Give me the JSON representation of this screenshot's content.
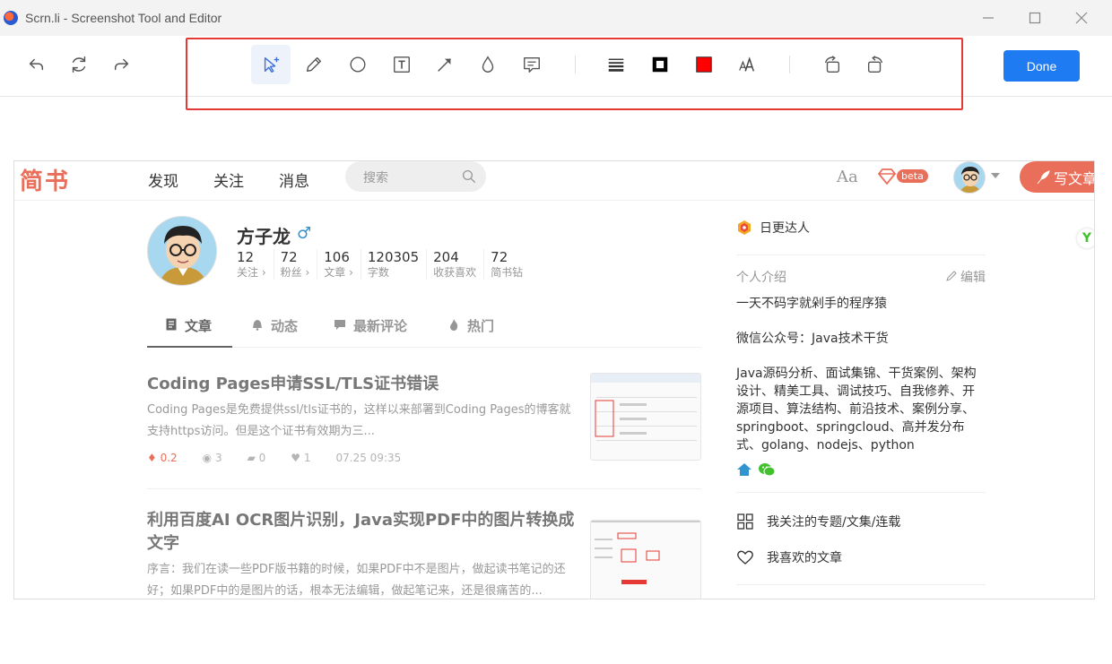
{
  "window": {
    "title": "Scrn.li - Screenshot Tool and Editor",
    "controls": {
      "minimize": "—",
      "maximize": "☐",
      "close": "✕"
    }
  },
  "toolbar": {
    "history": [
      "undo-icon",
      "refresh-icon",
      "redo-icon"
    ],
    "tools": [
      "select-icon",
      "pencil-icon",
      "ellipse-icon",
      "text-tool-icon",
      "arrow-icon",
      "blur-drop-icon",
      "comment-icon"
    ],
    "styles": [
      "line-width-icon",
      "stroke-icon",
      "fill-color-icon",
      "font-size-icon"
    ],
    "rotate": [
      "rotate-left-icon",
      "rotate-right-icon"
    ],
    "colors": {
      "stroke": "#000000",
      "fill": "#ff0000",
      "accent": "#1e7bf2",
      "highlight": "#e53935"
    },
    "done_label": "Done"
  },
  "jianshu": {
    "logo": "简书",
    "nav": [
      "发现",
      "关注",
      "消息"
    ],
    "search_placeholder": "搜索",
    "aa": "Aa",
    "beta": "beta",
    "write_label": "写文章",
    "brand_color": "#ea6f5a"
  },
  "profile": {
    "name": "方子龙",
    "gender_icon": "♂",
    "stats": [
      {
        "num": "12",
        "label": "关注 ›"
      },
      {
        "num": "72",
        "label": "粉丝 ›"
      },
      {
        "num": "106",
        "label": "文章 ›"
      },
      {
        "num": "120305",
        "label": "字数"
      },
      {
        "num": "204",
        "label": "收获喜欢"
      },
      {
        "num": "72",
        "label": "简书钻"
      }
    ]
  },
  "tabs": [
    "文章",
    "动态",
    "最新评论",
    "热门"
  ],
  "articles": [
    {
      "title": "Coding Pages申请SSL/TLS证书错误",
      "desc": "Coding Pages是免费提供ssl/tls证书的，这样以来部署到Coding Pages的博客就支持https访问。但是这个证书有效期为三...",
      "diamond": "0.2",
      "views": "3",
      "comments": "0",
      "likes": "1",
      "time": "07.25 09:35"
    },
    {
      "title": "利用百度AI OCR图片识别，Java实现PDF中的图片转换成文字",
      "desc": "序言：我们在读一些PDF版书籍的时候，如果PDF中不是图片，做起读书笔记的还好；如果PDF中的是图片的话，根本无法编辑，做起笔记来，还是很痛苦的..."
    }
  ],
  "sidebar": {
    "daily": "日更达人",
    "intro_head": "个人介绍",
    "edit": "编辑",
    "intro_lines": [
      "一天不码字就剁手的程序猿",
      "微信公众号：Java技术干货",
      "Java源码分析、面试集锦、干货案例、架构设计、精美工具、调试技巧、自我修养、开源项目、算法结构、前沿技术、案例分享、springboot、springcloud、高并发分布式、golang、nodejs、python"
    ],
    "links": [
      "我关注的专题/文集/连载",
      "我喜欢的文章"
    ]
  },
  "float_badge": "Y"
}
